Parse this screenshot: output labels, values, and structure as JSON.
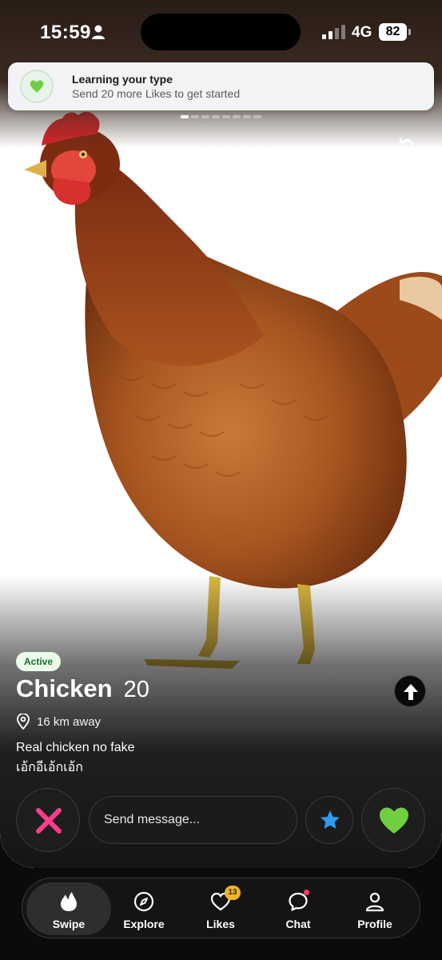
{
  "status_bar": {
    "time": "15:59",
    "network": "4G",
    "battery": "82"
  },
  "banner": {
    "title": "Learning your type",
    "subtitle": "Send 20 more Likes to get started"
  },
  "photos": {
    "count": 8,
    "current": 1
  },
  "profile": {
    "status_badge": "Active",
    "name": "Chicken",
    "age": "20",
    "distance": "16 km away",
    "bio_line1": "Real chicken no fake",
    "bio_line2": "เอ้กอีเอ้กเอ้ก"
  },
  "actions": {
    "message_placeholder": "Send message..."
  },
  "tabs": [
    {
      "label": "Swipe",
      "icon": "flame-icon",
      "selected": true
    },
    {
      "label": "Explore",
      "icon": "compass-icon",
      "selected": false
    },
    {
      "label": "Likes",
      "icon": "heart-outline-icon",
      "badge": "13",
      "selected": false
    },
    {
      "label": "Chat",
      "icon": "chat-bubble-icon",
      "selected": false
    },
    {
      "label": "Profile",
      "icon": "person-icon",
      "selected": false
    }
  ],
  "colors": {
    "nope": "#ff3d8b",
    "like": "#6fcf3f",
    "superlike": "#2b9cf2",
    "badge_gold": "#f0b429",
    "active_green": "#1d6b2b"
  }
}
